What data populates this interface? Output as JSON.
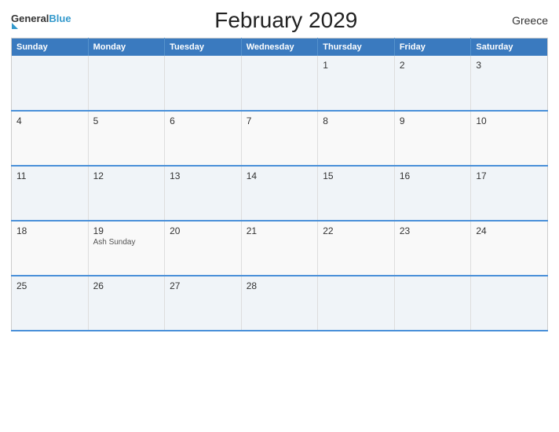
{
  "header": {
    "logo_general": "General",
    "logo_blue": "Blue",
    "title": "February 2029",
    "country": "Greece"
  },
  "calendar": {
    "days_of_week": [
      "Sunday",
      "Monday",
      "Tuesday",
      "Wednesday",
      "Thursday",
      "Friday",
      "Saturday"
    ],
    "weeks": [
      [
        {
          "day": "",
          "event": ""
        },
        {
          "day": "",
          "event": ""
        },
        {
          "day": "",
          "event": ""
        },
        {
          "day": "",
          "event": ""
        },
        {
          "day": "1",
          "event": ""
        },
        {
          "day": "2",
          "event": ""
        },
        {
          "day": "3",
          "event": ""
        }
      ],
      [
        {
          "day": "4",
          "event": ""
        },
        {
          "day": "5",
          "event": ""
        },
        {
          "day": "6",
          "event": ""
        },
        {
          "day": "7",
          "event": ""
        },
        {
          "day": "8",
          "event": ""
        },
        {
          "day": "9",
          "event": ""
        },
        {
          "day": "10",
          "event": ""
        }
      ],
      [
        {
          "day": "11",
          "event": ""
        },
        {
          "day": "12",
          "event": ""
        },
        {
          "day": "13",
          "event": ""
        },
        {
          "day": "14",
          "event": ""
        },
        {
          "day": "15",
          "event": ""
        },
        {
          "day": "16",
          "event": ""
        },
        {
          "day": "17",
          "event": ""
        }
      ],
      [
        {
          "day": "18",
          "event": ""
        },
        {
          "day": "19",
          "event": "Ash Sunday"
        },
        {
          "day": "20",
          "event": ""
        },
        {
          "day": "21",
          "event": ""
        },
        {
          "day": "22",
          "event": ""
        },
        {
          "day": "23",
          "event": ""
        },
        {
          "day": "24",
          "event": ""
        }
      ],
      [
        {
          "day": "25",
          "event": ""
        },
        {
          "day": "26",
          "event": ""
        },
        {
          "day": "27",
          "event": ""
        },
        {
          "day": "28",
          "event": ""
        },
        {
          "day": "",
          "event": ""
        },
        {
          "day": "",
          "event": ""
        },
        {
          "day": "",
          "event": ""
        }
      ]
    ]
  }
}
